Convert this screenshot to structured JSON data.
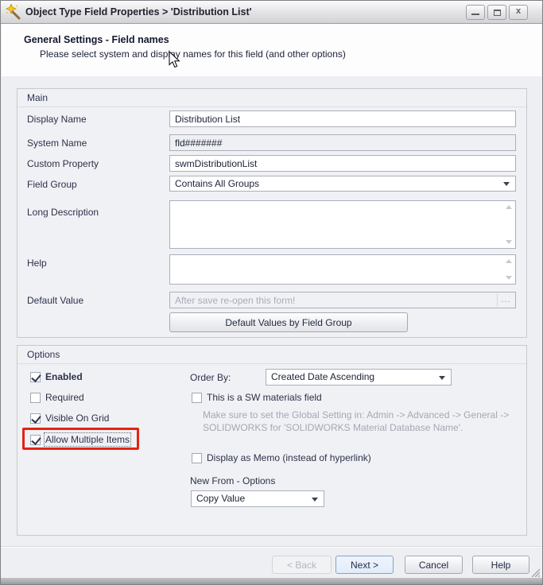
{
  "window": {
    "title": "Object Type Field Properties > 'Distribution List'",
    "icon": "wand-star-icon",
    "controls": {
      "minimize": "minimize-icon",
      "maximize": "maximize-icon",
      "close": "close-icon"
    },
    "close_glyph": "x"
  },
  "header": {
    "title": "General Settings - Field names",
    "subtitle": "Please select system and display names for this field (and other options)"
  },
  "main_group": {
    "label": "Main",
    "rows": {
      "display_name": {
        "label": "Display Name",
        "value": "Distribution List"
      },
      "system_name": {
        "label": "System Name",
        "value": "fld#######"
      },
      "custom_property": {
        "label": "Custom Property",
        "value": "swmDistributionList"
      },
      "field_group": {
        "label": "Field Group",
        "value": "Contains All Groups"
      },
      "long_description": {
        "label": "Long Description",
        "value": ""
      },
      "help": {
        "label": "Help",
        "value": ""
      },
      "default_value": {
        "label": "Default Value",
        "placeholder": "After save re-open this form!",
        "browse_glyph": "..."
      }
    },
    "button_default_values": "Default Values by Field Group"
  },
  "options_group": {
    "label": "Options",
    "checkboxes": {
      "enabled": {
        "label": "Enabled",
        "checked": true,
        "bold": true
      },
      "required": {
        "label": "Required",
        "checked": false
      },
      "visible_on_grid": {
        "label": "Visible On Grid",
        "checked": true
      },
      "allow_multiple_items": {
        "label": "Allow Multiple Items",
        "checked": true,
        "highlighted": true
      },
      "sw_materials": {
        "label": "This is a SW materials field",
        "checked": false
      },
      "display_memo": {
        "label": "Display as Memo (instead of hyperlink)",
        "checked": false
      }
    },
    "order_by": {
      "label": "Order By:",
      "value": "Created Date Ascending"
    },
    "note_lines": [
      "Make sure to set the Global Setting in: Admin -> Advanced -> General ->",
      "SOLIDWORKS for 'SOLIDWORKS Material Database Name'."
    ],
    "new_from_label": "New From - Options",
    "new_from_value": "Copy Value"
  },
  "footer": {
    "back_label": "< Back",
    "next_label": "Next >",
    "cancel_label": "Cancel",
    "help_label": "Help"
  },
  "colors": {
    "highlight_red": "#e42313",
    "default_button_bg": "#e6eefb",
    "default_button_border": "#8ca0c4",
    "titlebar_gradient_top": "#fbfbfc",
    "titlebar_gradient_bottom": "#d3d3d6"
  }
}
